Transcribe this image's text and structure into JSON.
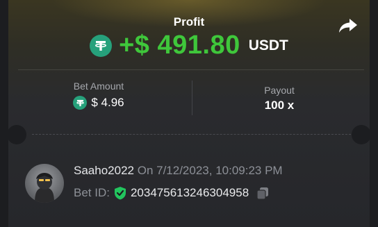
{
  "header": {
    "profit_label": "Profit",
    "profit_amount": "+$ 491.80",
    "profit_currency": "USDT",
    "share_icon": "share-arrow-icon"
  },
  "stats": {
    "bet_amount_label": "Bet Amount",
    "bet_amount_value": "$ 4.96",
    "payout_label": "Payout",
    "payout_value": "100 x",
    "currency_icon": "tether-icon"
  },
  "user": {
    "username": "Saaho2022",
    "date_text": "On 7/12/2023, 10:09:23 PM",
    "bet_id_label": "Bet ID:",
    "bet_id": "203475613246304958",
    "verified_icon": "shield-check-icon",
    "copy_icon": "copy-icon",
    "avatar_icon": "avatar"
  },
  "colors": {
    "profit_green": "#3fc73b",
    "tether": "#26a17b",
    "verified_green": "#22c55e"
  }
}
